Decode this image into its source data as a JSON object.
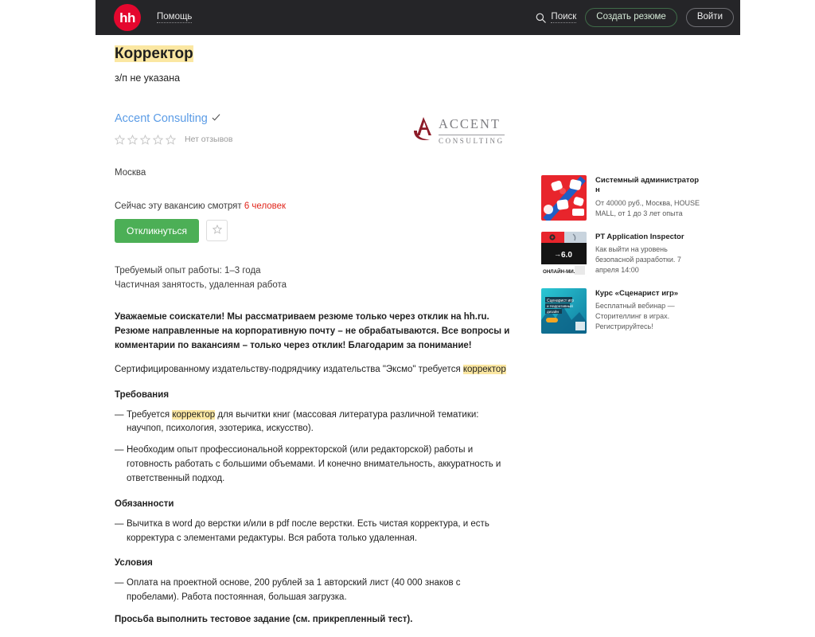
{
  "header": {
    "logo_text": "hh",
    "help_label": "Помощь",
    "search_label": "Поиск",
    "create_resume_label": "Создать резюме",
    "login_label": "Войти",
    "bg_color": "#252528",
    "logo_color": "#e4072e"
  },
  "vacancy": {
    "title": "Корректор",
    "salary": "з/п не указана",
    "company": "Accent Consulting",
    "reviews": "Нет отзывов",
    "stars_count": 5,
    "stars_filled": 0,
    "city": "Москва",
    "viewers_prefix": "Сейчас эту вакансию смотрят ",
    "viewers_count": "6 человек",
    "apply_label": "Откликнуться",
    "experience": "Требуемый опыт работы: 1–3 года",
    "employment": "Частичная занятость, удаленная работа",
    "highlight_color": "#fbe7a2",
    "apply_color": "#4caf56",
    "viewers_color": "#e1251b",
    "company_link_color": "#5b9ce6"
  },
  "company_logo": {
    "line1": "ACCENT",
    "line2": "CONSULTING",
    "mark_color": "#8c1b28"
  },
  "description": {
    "intro_bold": "Уважаемые соискатели! Мы рассматриваем резюме только через отклик на hh.ru. Резюме направленные на корпоративную почту – не обрабатываются. Все вопросы и комментарии по вакансиям – только через отклик! Благодарим за понимание!",
    "lead_before": "Сертифицированному издательству-подрядчику издательства \"Эксмо\" требуется ",
    "lead_highlight": "корректор",
    "lead_after": "",
    "sections": [
      {
        "heading": "Требования",
        "items": [
          {
            "before": "Требуется ",
            "highlight": "корректор",
            "after": " для вычитки книг (массовая литература различной тематики: научпоп, психология, эзотерика, искусство)."
          },
          {
            "before": "Необходим опыт профессиональной корректорской (или редакторской) работы и готовность работать с большими объемами. И конечно внимательность, аккуратность и ответственный подход.",
            "highlight": "",
            "after": ""
          }
        ]
      },
      {
        "heading": "Обязанности",
        "items": [
          {
            "before": "Вычитка в word до верстки и/или в pdf после верстки. Есть чистая корректура, и есть корректура с элементами редактуры. Вся работа только удаленная.",
            "highlight": "",
            "after": ""
          }
        ]
      },
      {
        "heading": "Условия",
        "items": [
          {
            "before": "Оплата на проектной основе, 200 рублей за 1 авторский лист (40 000 знаков с пробелами). Работа постоянная, большая загрузка.",
            "highlight": "",
            "after": ""
          }
        ]
      }
    ],
    "closing_bold": "Просьба выполнить тестовое задание (см. прикрепленный тест)."
  },
  "ads": [
    {
      "title": "Системный администратор н",
      "desc": "От 40000 руб., Москва, HOUSE MALL, от 1 до 3 лет опыта",
      "thumb": "red-banner"
    },
    {
      "title": "PT Application Inspector",
      "desc": "Как выйти на уровень безопасной разработки. 7 апреля 14:00",
      "thumb": "dark-banner"
    },
    {
      "title": "Курс «Сценарист игр»",
      "desc": "Бесплатный вебинар — Сторителлинг в играх. Регистрируйтесь!",
      "thumb": "teal-banner"
    }
  ]
}
